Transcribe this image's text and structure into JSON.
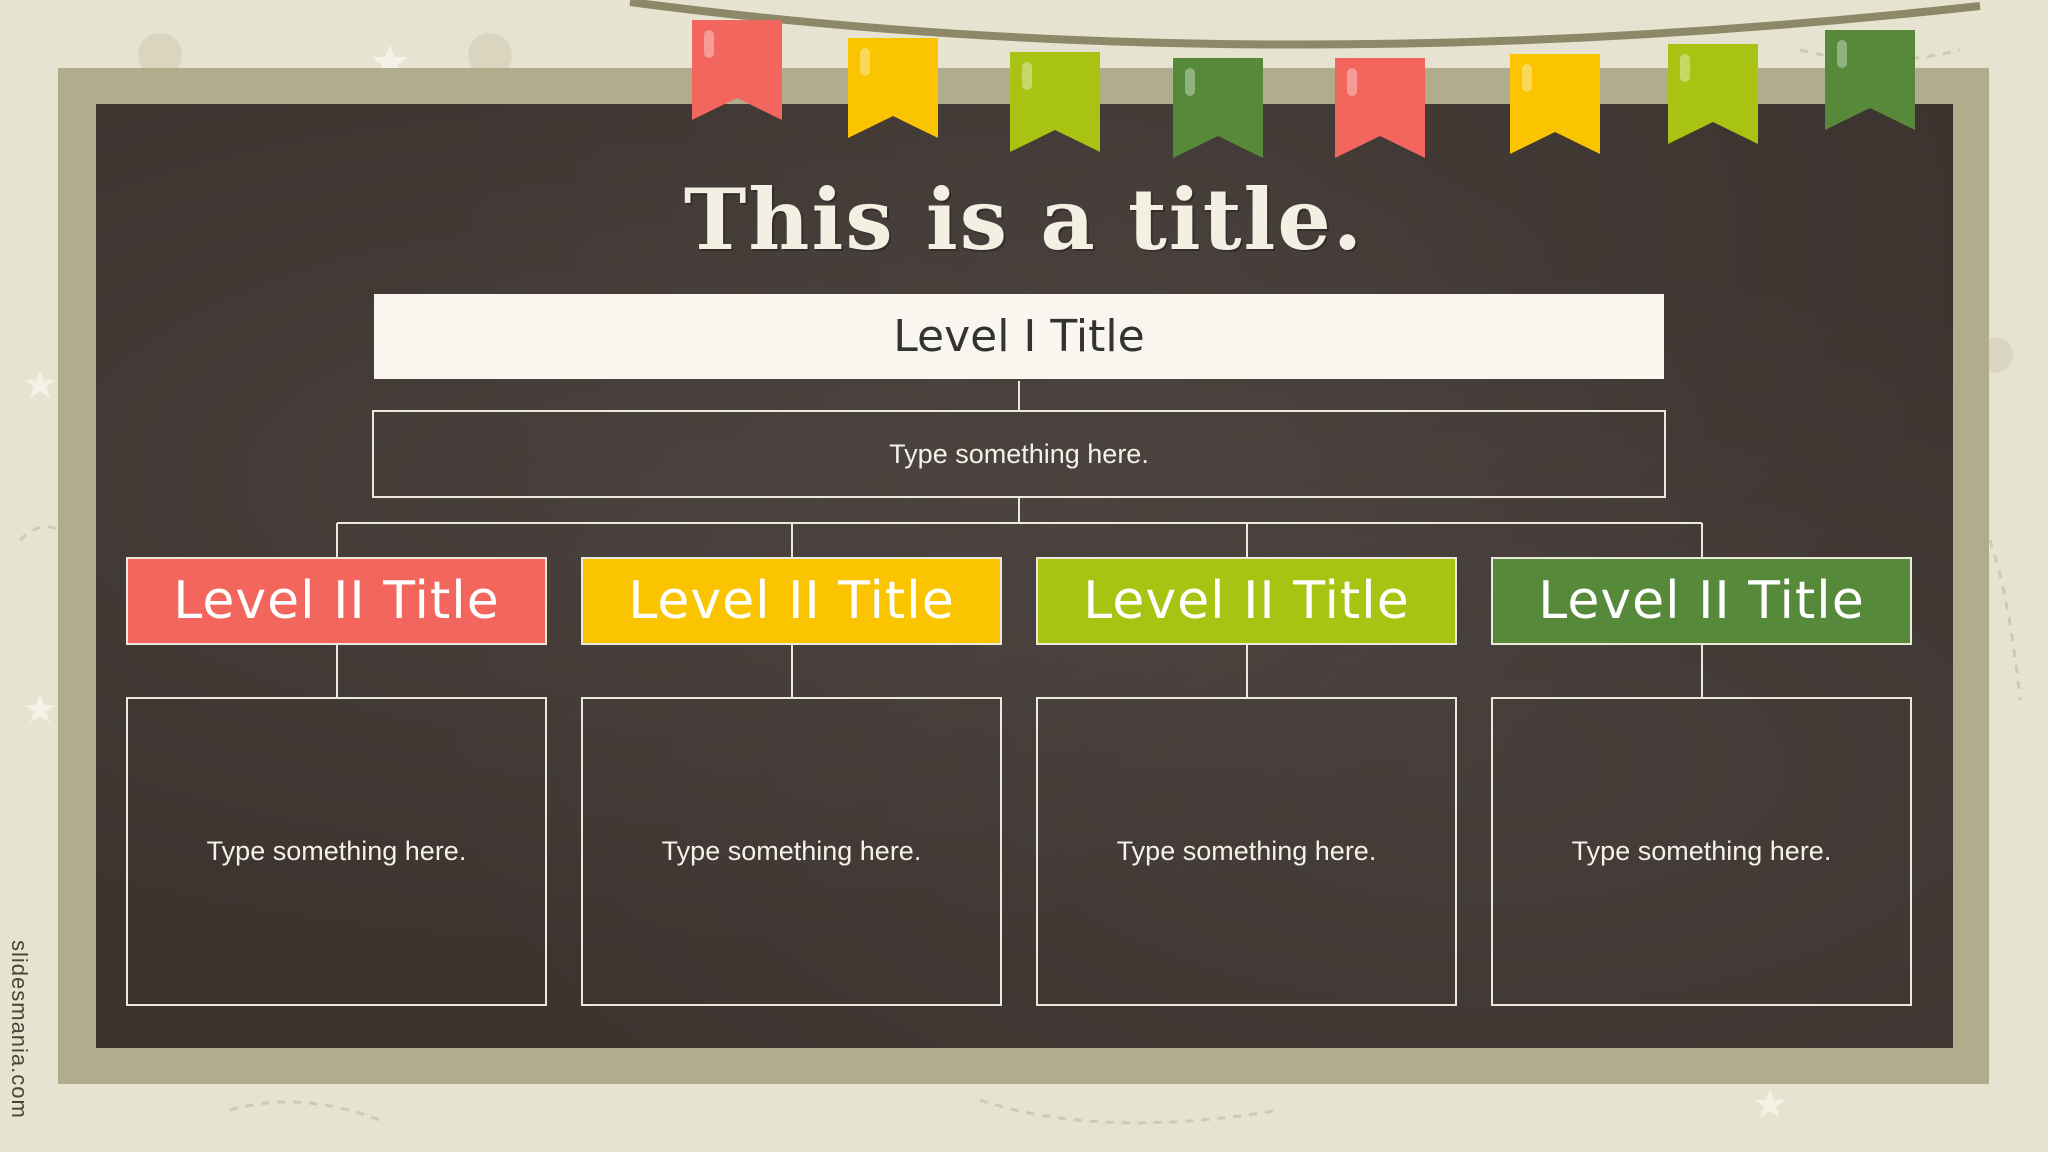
{
  "slide": {
    "title": "This is a title.",
    "level1": {
      "title": "Level I Title",
      "text": "Type something here."
    },
    "level2": [
      {
        "title": "Level II Title",
        "text": "Type something here.",
        "color": "#f2665e"
      },
      {
        "title": "Level II Title",
        "text": "Type something here.",
        "color": "#fbc401"
      },
      {
        "title": "Level II Title",
        "text": "Type something here.",
        "color": "#a9c312"
      },
      {
        "title": "Level II Title",
        "text": "Type something here.",
        "color": "#57893b"
      }
    ]
  },
  "branding": {
    "text": "slidesmania.com"
  },
  "colors": {
    "background": "#e6e3d0",
    "frame": "#b1ad8c",
    "board": "#3d3430",
    "flags": [
      "#f2665e",
      "#fbc401",
      "#a9c312",
      "#57893b"
    ]
  }
}
